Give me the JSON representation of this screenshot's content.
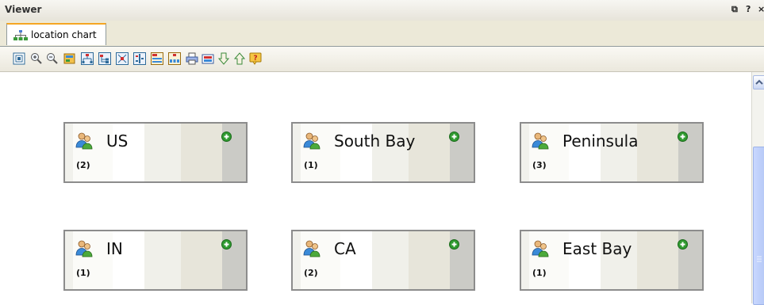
{
  "window": {
    "title": "Viewer",
    "controls": [
      "⧉",
      "?",
      "×"
    ]
  },
  "tab": {
    "label": "location chart",
    "icon": "org-chart-icon",
    "accent": "#f5a623"
  },
  "toolbar": {
    "icons": [
      "fit-page-icon",
      "zoom-in-icon",
      "zoom-out-icon",
      "find-icon",
      "layout-top-down-icon",
      "layout-left-right-icon",
      "layout-compact-icon",
      "layout-list-icon",
      "layout-vertical-icon",
      "layout-horizontal-icon",
      "print-icon",
      "export-icon",
      "move-down-icon",
      "move-up-icon",
      "help-icon"
    ]
  },
  "nodes": [
    {
      "name": "US",
      "count": "(2)"
    },
    {
      "name": "South Bay",
      "count": "(1)"
    },
    {
      "name": "Peninsula",
      "count": "(3)"
    },
    {
      "name": "IN",
      "count": "(1)"
    },
    {
      "name": "CA",
      "count": "(2)"
    },
    {
      "name": "East Bay",
      "count": "(1)"
    }
  ],
  "colors": {
    "expand_green": "#2f9a2f",
    "scroll_thumb": "#b6c9f6"
  }
}
